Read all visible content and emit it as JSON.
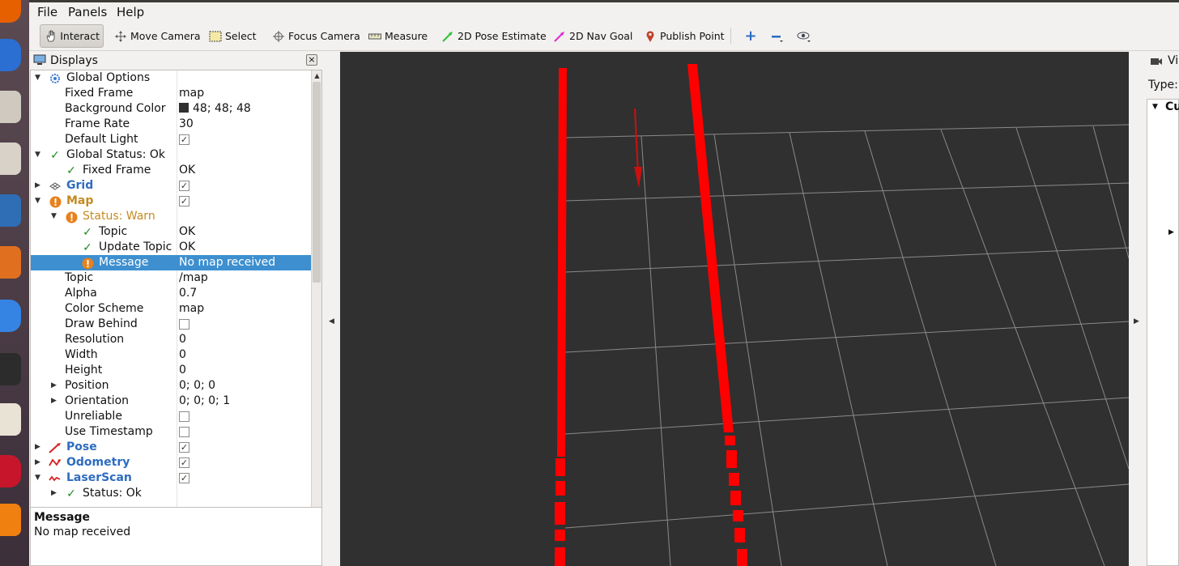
{
  "menu": {
    "file": "File",
    "panels": "Panels",
    "help": "Help"
  },
  "toolbar": {
    "interact": "Interact",
    "move_camera": "Move Camera",
    "select": "Select",
    "focus_camera": "Focus Camera",
    "measure": "Measure",
    "pose_estimate": "2D Pose Estimate",
    "nav_goal": "2D Nav Goal",
    "publish_point": "Publish Point"
  },
  "displays": {
    "title": "Displays",
    "rows": [
      {
        "name": "Global Options",
        "value": ""
      },
      {
        "name": "Fixed Frame",
        "value": "map"
      },
      {
        "name": "Background Color",
        "value": "48; 48; 48"
      },
      {
        "name": "Frame Rate",
        "value": "30"
      },
      {
        "name": "Default Light",
        "value": ""
      },
      {
        "name": "Global Status: Ok",
        "value": ""
      },
      {
        "name": "Fixed Frame",
        "value": "OK"
      },
      {
        "name": "Grid",
        "value": ""
      },
      {
        "name": "Map",
        "value": ""
      },
      {
        "name": "Status: Warn",
        "value": ""
      },
      {
        "name": "Topic",
        "value": "OK"
      },
      {
        "name": "Update Topic",
        "value": "OK"
      },
      {
        "name": "Message",
        "value": "No map received"
      },
      {
        "name": "Topic",
        "value": "/map"
      },
      {
        "name": "Alpha",
        "value": "0.7"
      },
      {
        "name": "Color Scheme",
        "value": "map"
      },
      {
        "name": "Draw Behind",
        "value": ""
      },
      {
        "name": "Resolution",
        "value": "0"
      },
      {
        "name": "Width",
        "value": "0"
      },
      {
        "name": "Height",
        "value": "0"
      },
      {
        "name": "Position",
        "value": "0; 0; 0"
      },
      {
        "name": "Orientation",
        "value": "0; 0; 0; 1"
      },
      {
        "name": "Unreliable",
        "value": ""
      },
      {
        "name": "Use Timestamp",
        "value": ""
      },
      {
        "name": "Pose",
        "value": ""
      },
      {
        "name": "Odometry",
        "value": ""
      },
      {
        "name": "LaserScan",
        "value": ""
      },
      {
        "name": "Status: Ok",
        "value": ""
      }
    ]
  },
  "message_panel": {
    "heading": "Message",
    "body": "No map received"
  },
  "views": {
    "title": "Vi",
    "type_label": "Type:",
    "item": "Cu"
  },
  "colors": {
    "background": "#303030",
    "laser": "#ff0000",
    "selection": "#3d8fcf"
  }
}
